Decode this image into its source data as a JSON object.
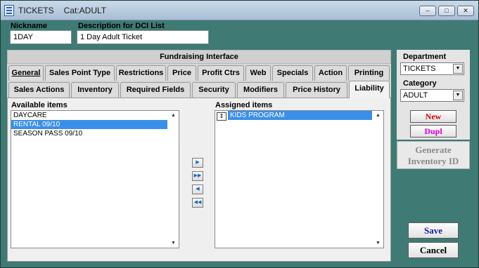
{
  "window": {
    "title": "TICKETS",
    "category_text": "Cat:ADULT",
    "controls": [
      "–",
      "□",
      "✕"
    ]
  },
  "nickname": {
    "label": "Nickname",
    "value": "1DAY"
  },
  "description": {
    "label": "Description for DCI List",
    "value": "1 Day Adult Ticket"
  },
  "fundraising_header": "Fundraising Interface",
  "tabs_row1": [
    "General",
    "Sales Point Type",
    "Restrictions",
    "Price",
    "Profit Ctrs",
    "Web",
    "Specials",
    "Action",
    "Printing"
  ],
  "tabs_row2": [
    "Sales Actions",
    "Inventory",
    "Required Fields",
    "Security",
    "Modifiers",
    "Price History",
    "Liability"
  ],
  "active_tab": "Liability",
  "available": {
    "label": "Available items",
    "items": [
      "DAYCARE",
      "RENTAL 09/10",
      "SEASON PASS 09/10"
    ],
    "selected_index": 1
  },
  "assigned": {
    "label": "Assigned items",
    "items": [
      "KIDS PROGRAM"
    ],
    "selected_index": 0
  },
  "move_buttons": [
    "▶",
    "▶▶",
    "◀",
    "◀◀"
  ],
  "department": {
    "label": "Department",
    "value": "TICKETS"
  },
  "category": {
    "label": "Category",
    "value": "ADULT"
  },
  "buttons": {
    "new": "New",
    "dupl": "Dupl",
    "generate": "Generate Inventory ID",
    "save": "Save",
    "cancel": "Cancel"
  },
  "colors": {
    "background": "#3f7a74",
    "new_text": "#cc0000",
    "dupl_text": "#e000e0",
    "save_text": "#1a1aa8",
    "selection": "#3b8fe8"
  }
}
